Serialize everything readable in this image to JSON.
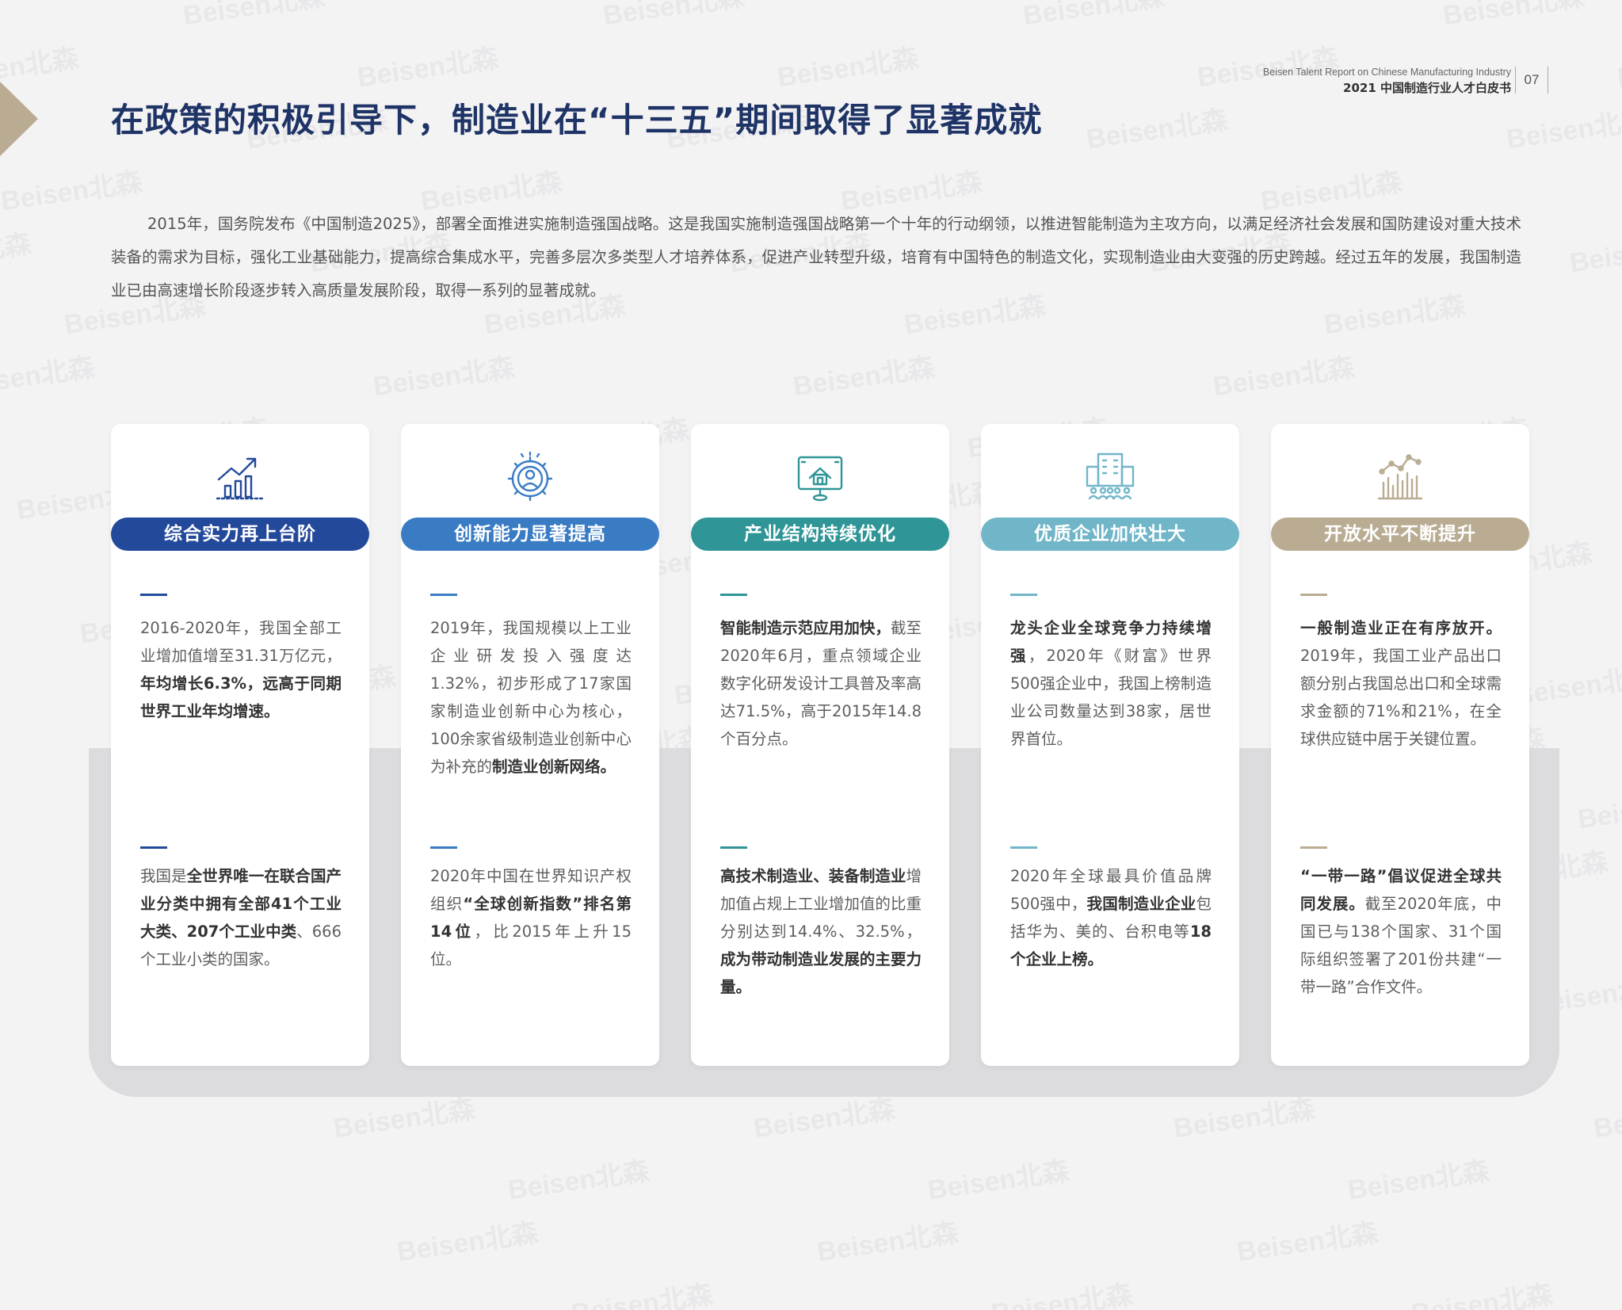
{
  "header": {
    "en": "Beisen Talent Report on Chinese Manufacturing Industry",
    "cn": "2021 中国制造行业人才白皮书",
    "page_number": "07"
  },
  "title": "在政策的积极引导下，制造业在“十三五”期间取得了显著成就",
  "intro": "2015年，国务院发布《中国制造2025》，部署全面推进实施制造强国战略。这是我国实施制造强国战略第一个十年的行动纲领，以推进智能制造为主攻方向，以满足经济社会发展和国防建设对重大技术装备的需求为目标，强化工业基础能力，提高综合集成水平，完善多层次多类型人才培养体系，促进产业转型升级，培育有中国特色的制造文化，实现制造业由大变强的历史跨越。经过五年的发展，我国制造业已由高速增长阶段逐步转入高质量发展阶段，取得一系列的显著成就。",
  "watermark": "Beisen北森",
  "colors": {
    "title": "#1f3466",
    "card1": "#23499a",
    "card2": "#3a7cc4",
    "card3": "#2f9596",
    "card4": "#70b6c8",
    "card5": "#b9ac93"
  },
  "cards": [
    {
      "icon": "growth-chart-icon",
      "label": "综合实力再上台阶",
      "p1": [
        {
          "t": "2016-2020年，我国全部工业增加值增至31.31万亿元，"
        },
        {
          "b": "年均增长6.3%，远高于同期世界工业年均增速。"
        }
      ],
      "p2": [
        {
          "t": "我国是"
        },
        {
          "b": "全世界唯一在联合国产业分类中拥有全部41个工业大类、207个工业中类"
        },
        {
          "t": "、666个工业小类的国家。"
        }
      ]
    },
    {
      "icon": "innovation-gear-icon",
      "label": "创新能力显著提高",
      "p1": [
        {
          "t": "2019年，我国规模以上工业企业研发投入强度达1.32%，初步形成了17家国家制造业创新中心为核心，100余家省级制造业创新中心为补充的"
        },
        {
          "b": "制造业创新网络。"
        }
      ],
      "p2": [
        {
          "t": "2020年中国在世界知识产权组织"
        },
        {
          "b": "“全球创新指数”排名第14位"
        },
        {
          "t": "，比2015年上升15位。"
        }
      ]
    },
    {
      "icon": "smart-monitor-icon",
      "label": "产业结构持续优化",
      "p1": [
        {
          "b": "智能制造示范应用加快，"
        },
        {
          "t": "截至2020年6月，重点领域企业数字化研发设计工具普及率高达71.5%，高于2015年14.8个百分点。"
        }
      ],
      "p2": [
        {
          "b": "高技术制造业、装备制造业"
        },
        {
          "t": "增加值占规上工业增加值的比重分别达到14.4%、32.5%，"
        },
        {
          "b": "成为带动制造业发展的主要力量。"
        }
      ]
    },
    {
      "icon": "enterprise-building-icon",
      "label": "优质企业加快壮大",
      "p1": [
        {
          "b": "龙头企业全球竞争力持续增强"
        },
        {
          "t": "，2020年《财富》世界500强企业中，我国上榜制造业公司数量达到38家，居世界首位。"
        }
      ],
      "p2": [
        {
          "t": "2020年全球最具价值品牌500强中，"
        },
        {
          "b": "我国制造业企业"
        },
        {
          "t": "包括华为、美的、台积电等"
        },
        {
          "b": "18个企业上榜。"
        }
      ]
    },
    {
      "icon": "opening-chart-icon",
      "label": "开放水平不断提升",
      "p1": [
        {
          "b": "一般制造业正在有序放开。"
        },
        {
          "t": "2019年，我国工业产品出口额分别占我国总出口和全球需求金额的71%和21%，在全球供应链中居于关键位置。"
        }
      ],
      "p2": [
        {
          "b": "“一带一路”倡议促进全球共同发展。"
        },
        {
          "t": "截至2020年底，中国已与138个国家、31个国际组织签署了201份共建“一带一路”合作文件。"
        }
      ]
    }
  ]
}
